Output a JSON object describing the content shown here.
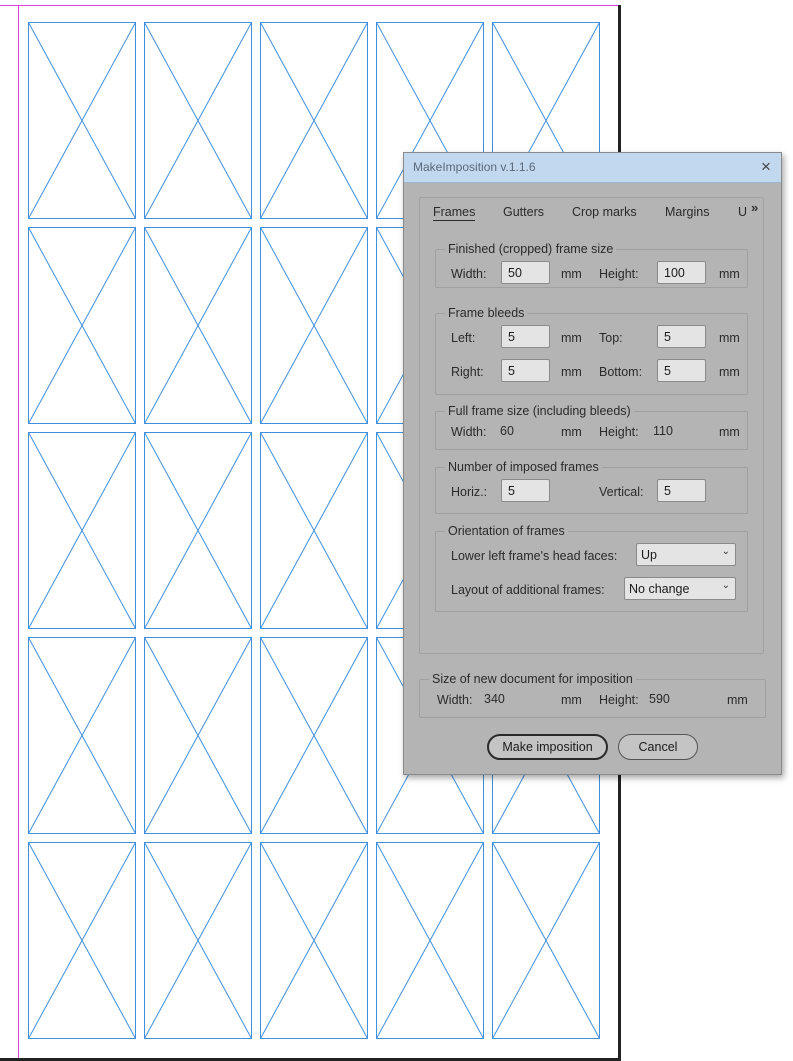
{
  "document": {
    "frame_grid": {
      "columns": 5,
      "rows": 5
    },
    "colors": {
      "frame_stroke": "#3f8fdc",
      "page_edge": "#e040e0",
      "page_shadow": "#222222"
    }
  },
  "dialog": {
    "title": "MakeImposition v.1.1.6",
    "close_icon": "×",
    "tabs": [
      {
        "label": "Frames",
        "active": true
      },
      {
        "label": "Gutters",
        "active": false
      },
      {
        "label": "Crop marks",
        "active": false
      },
      {
        "label": "Margins",
        "active": false
      },
      {
        "label": "U",
        "active": false
      }
    ],
    "tab_overflow_icon": "»",
    "finished_size": {
      "legend": "Finished (cropped) frame size",
      "width_label": "Width:",
      "width_value": "50",
      "width_unit": "mm",
      "height_label": "Height:",
      "height_value": "100",
      "height_unit": "mm"
    },
    "bleeds": {
      "legend": "Frame bleeds",
      "left_label": "Left:",
      "left_value": "5",
      "left_unit": "mm",
      "top_label": "Top:",
      "top_value": "5",
      "top_unit": "mm",
      "right_label": "Right:",
      "right_value": "5",
      "right_unit": "mm",
      "bottom_label": "Bottom:",
      "bottom_value": "5",
      "bottom_unit": "mm"
    },
    "full_size": {
      "legend": "Full frame size (including bleeds)",
      "width_label": "Width:",
      "width_value": "60",
      "width_unit": "mm",
      "height_label": "Height:",
      "height_value": "110",
      "height_unit": "mm"
    },
    "imposed": {
      "legend": "Number of imposed frames",
      "horiz_label": "Horiz.:",
      "horiz_value": "5",
      "vertical_label": "Vertical:",
      "vertical_value": "5"
    },
    "orientation": {
      "legend": "Orientation of frames",
      "head_label": "Lower left frame's head faces:",
      "head_value": "Up",
      "layout_label": "Layout of additional frames:",
      "layout_value": "No change",
      "chevron_icon": "⌄"
    },
    "new_doc": {
      "legend": "Size of new document for imposition",
      "width_label": "Width:",
      "width_value": "340",
      "width_unit": "mm",
      "height_label": "Height:",
      "height_value": "590",
      "height_unit": "mm"
    },
    "buttons": {
      "make": "Make imposition",
      "cancel": "Cancel"
    }
  }
}
